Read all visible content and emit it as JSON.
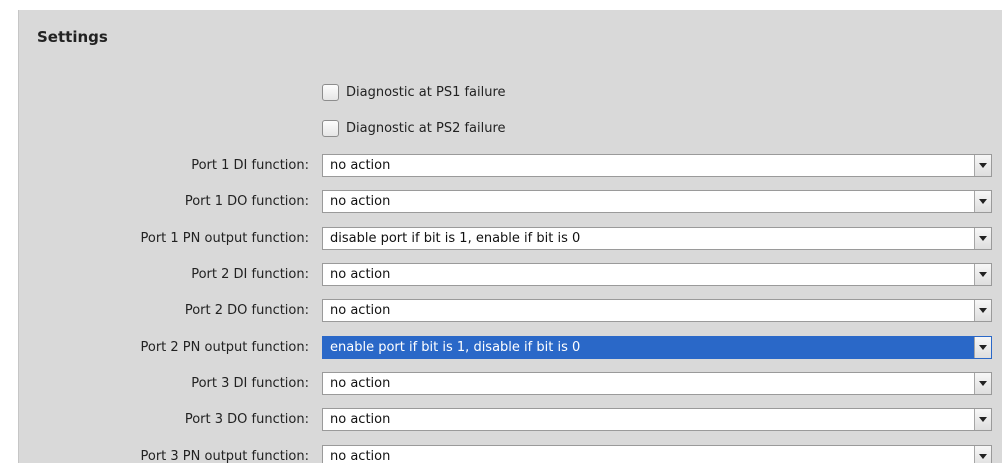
{
  "section": {
    "title": "Settings"
  },
  "checkboxes": [
    {
      "label": "Diagnostic at PS1 failure",
      "checked": false
    },
    {
      "label": "Diagnostic at PS2 failure",
      "checked": false
    }
  ],
  "fields": [
    {
      "label": "Port 1 DI function:",
      "value": "no action",
      "selected": false
    },
    {
      "label": "Port 1 DO function:",
      "value": "no action",
      "selected": false
    },
    {
      "label": "Port 1 PN output function:",
      "value": "disable port if bit is 1, enable if bit is 0",
      "selected": false
    },
    {
      "label": "Port 2 DI function:",
      "value": "no action",
      "selected": false
    },
    {
      "label": "Port 2 DO function:",
      "value": "no action",
      "selected": false
    },
    {
      "label": "Port 2 PN output function:",
      "value": "enable port if bit is 1, disable if bit is 0",
      "selected": true
    },
    {
      "label": "Port 3 DI function:",
      "value": "no action",
      "selected": false
    },
    {
      "label": "Port 3 DO function:",
      "value": "no action",
      "selected": false
    },
    {
      "label": "Port 3 PN output function:",
      "value": "no action",
      "selected": false
    }
  ],
  "colors": {
    "panel_background": "#d9d9d9",
    "selection_highlight": "#2a68c8",
    "field_background": "#ffffff"
  },
  "icons": {
    "dropdown": "chevron-down-icon"
  }
}
